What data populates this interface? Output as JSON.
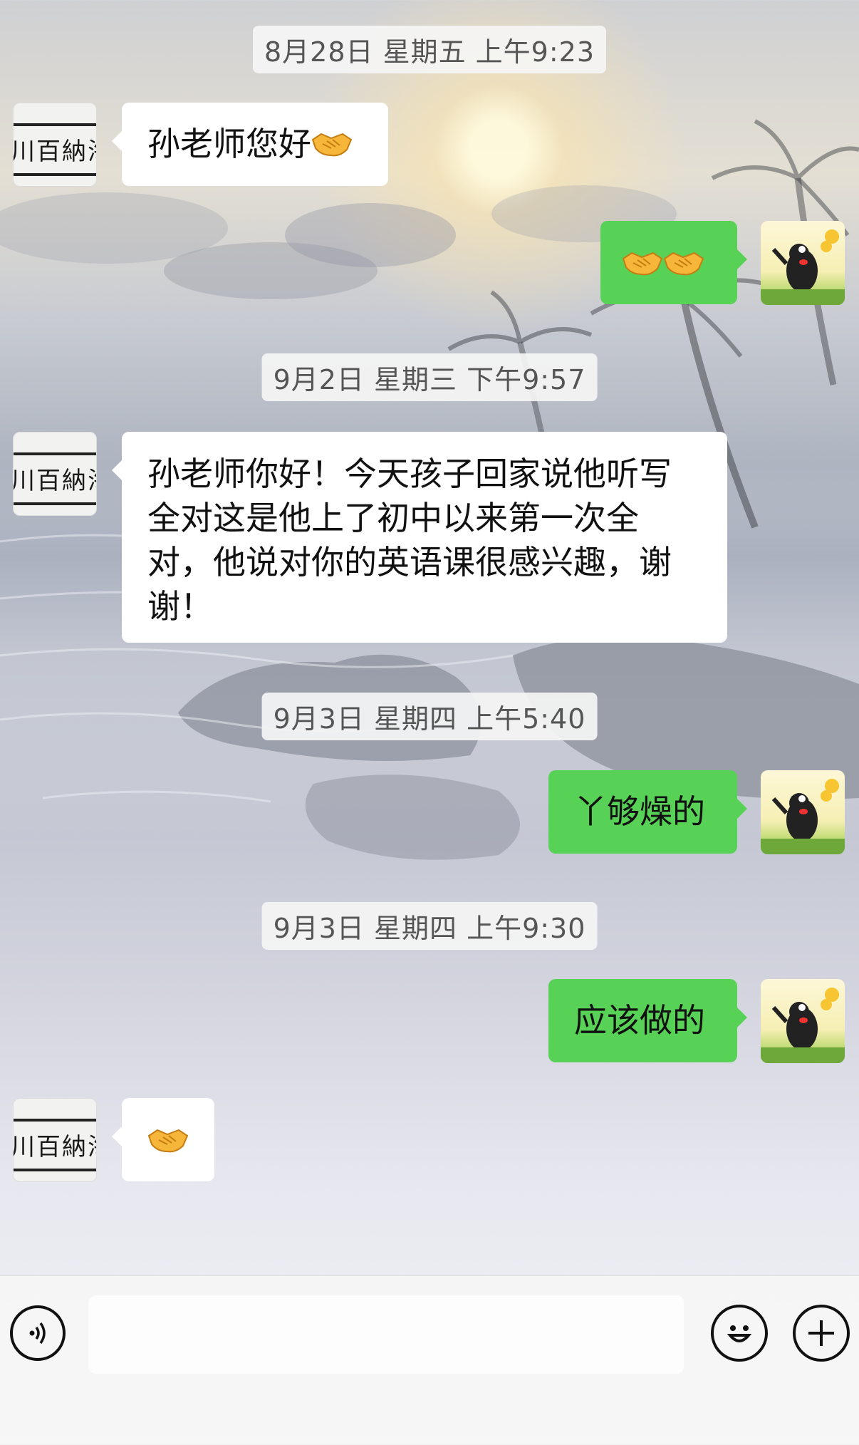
{
  "timestamps": [
    "8月28日 星期五 上午9:23",
    "9月2日 星期三 下午9:57",
    "9月3日 星期四 上午5:40",
    "9月3日 星期四 上午9:30"
  ],
  "contact": {
    "avatar_text": "川百納海"
  },
  "messages": [
    {
      "side": "left",
      "text": "孙老师您好",
      "emoji": "handshake-icon"
    },
    {
      "side": "right",
      "text": "",
      "emoji": "handshake-icon x2"
    },
    {
      "side": "left",
      "text": "孙老师你好！今天孩子回家说他听写全对这是他上了初中以来第一次全对，他说对你的英语课很感兴趣，谢谢！"
    },
    {
      "side": "right",
      "text": "丫够燥的"
    },
    {
      "side": "right",
      "text": "应该做的"
    },
    {
      "side": "left",
      "text": "",
      "emoji": "handshake-icon"
    }
  ],
  "m3_lines": [
    "孙老师你好！今天孩子回家说他听写",
    "全对这是他上了初中以来第一次全",
    "对，他说对你的英语课很感兴趣，谢",
    "谢！"
  ],
  "colors": {
    "bubble_sent": "#58d256",
    "bubble_received": "#ffffff"
  },
  "input_bar": {
    "input_value": ""
  }
}
